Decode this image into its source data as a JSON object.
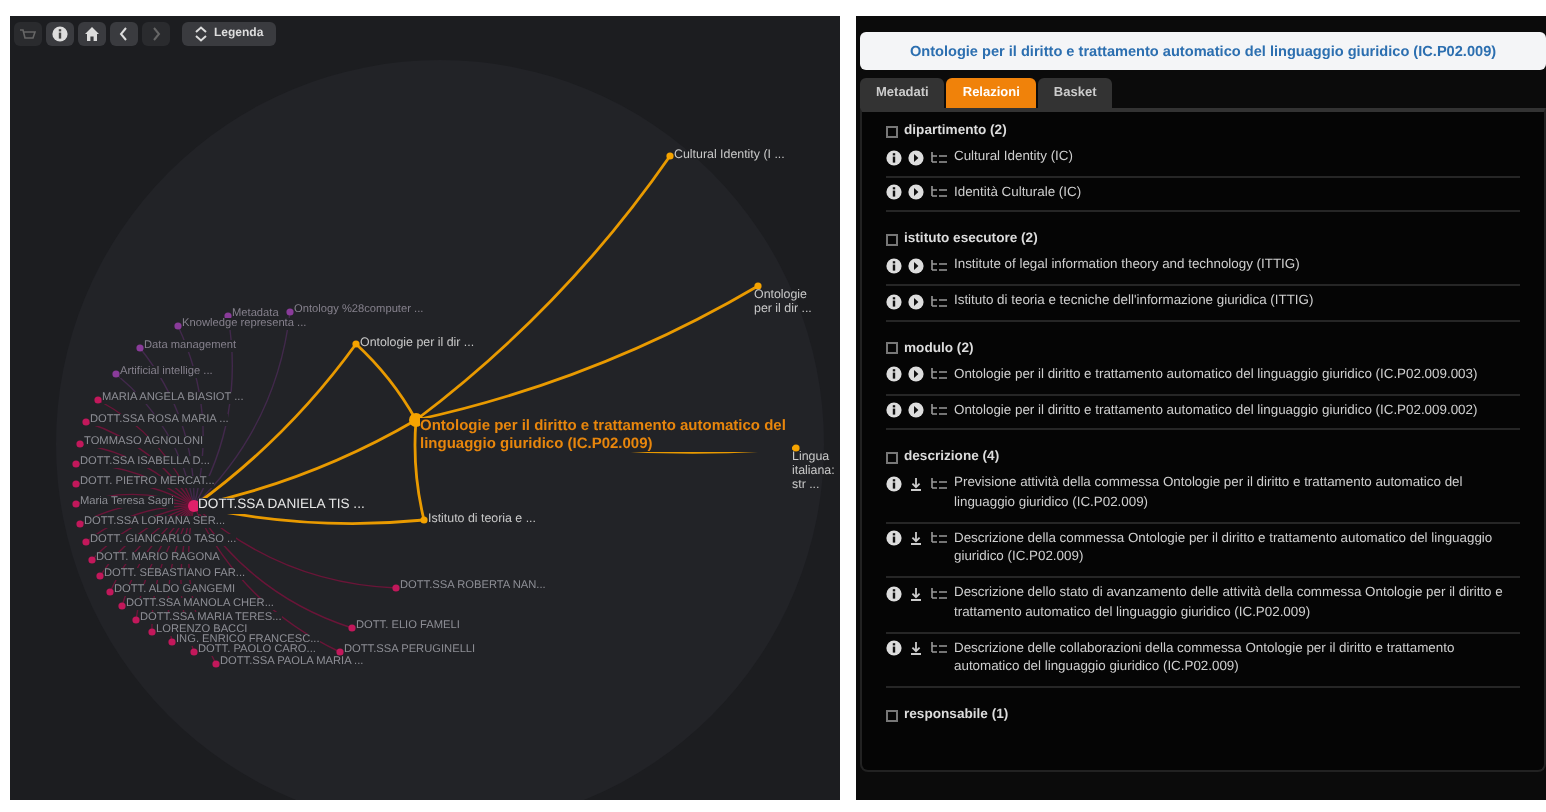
{
  "toolbar": {
    "buttons": [
      {
        "kind": "basket",
        "disabled": true
      },
      {
        "kind": "info",
        "disabled": false
      },
      {
        "kind": "home",
        "disabled": false
      },
      {
        "kind": "back",
        "disabled": false
      },
      {
        "kind": "forward",
        "disabled": true
      }
    ],
    "legend_button": "Legenda"
  },
  "graph": {
    "nodes": [
      {
        "label": "Cultural Identity (I ...",
        "kind": "related"
      },
      {
        "label": "Metadata",
        "kind": "topic"
      },
      {
        "label": "Ontology %28computer ...",
        "kind": "topic"
      },
      {
        "label": "Ontologie per il dir ...",
        "kind": "related"
      },
      {
        "label": "Knowledge representa ...",
        "kind": "topic"
      },
      {
        "label": "Data management",
        "kind": "topic"
      },
      {
        "label": "Ontologie per il dir ...",
        "kind": "related"
      },
      {
        "label": "Artificial intellige ...",
        "kind": "topic"
      },
      {
        "label": "MARIA ANGELA BIASIOT ...",
        "kind": "person"
      },
      {
        "label": "DOTT.SSA ROSA MARIA ...",
        "kind": "person"
      },
      {
        "label": "TOMMASO AGNOLONI",
        "kind": "person"
      },
      {
        "label": "Ontologie per il diritto e trattamento automatico del linguaggio giuridico (IC.P02.009)",
        "kind": "center"
      },
      {
        "label": "DOTT.SSA ISABELLA D...",
        "kind": "person"
      },
      {
        "label": "DOTT. PIETRO MERCAT...",
        "kind": "person"
      },
      {
        "label": "Lingua italiana: str ...",
        "kind": "related"
      },
      {
        "label": "Maria Teresa Sagri",
        "kind": "person"
      },
      {
        "label": "DOTT.SSA DANIELA TIS ...",
        "kind": "focus"
      },
      {
        "label": "DOTT.SSA LORIANA SER...",
        "kind": "person"
      },
      {
        "label": "Istituto di teoria e ...",
        "kind": "related"
      },
      {
        "label": "DOTT. GIANCARLO TASO ...",
        "kind": "person"
      },
      {
        "label": "DOTT. MARIO RAGONA",
        "kind": "person"
      },
      {
        "label": "DOTT. SEBASTIANO FAR...",
        "kind": "person"
      },
      {
        "label": "DOTT. ALDO GANGEMI",
        "kind": "person"
      },
      {
        "label": "DOTT.SSA ROBERTA NAN...",
        "kind": "person"
      },
      {
        "label": "DOTT.SSA MANOLA CHER...",
        "kind": "person"
      },
      {
        "label": "DOTT.SSA MARIA TERES...",
        "kind": "person"
      },
      {
        "label": "LORENZO BACCI",
        "kind": "person"
      },
      {
        "label": "DOTT. ELIO FAMELI",
        "kind": "person"
      },
      {
        "label": "ING. ENRICO FRANCESC...",
        "kind": "person"
      },
      {
        "label": "DOTT. PAOLO CARO...",
        "kind": "person"
      },
      {
        "label": "DOTT.SSA PERUGINELLI",
        "kind": "person"
      },
      {
        "label": "DOTT.SSA PAOLA MARIA ...",
        "kind": "person"
      }
    ]
  },
  "detail": {
    "title": "Ontologie per il diritto e trattamento automatico del linguaggio giuridico (IC.P02.009)",
    "tabs": [
      {
        "label": "Metadati",
        "selected": false
      },
      {
        "label": "Relazioni",
        "selected": true
      },
      {
        "label": "Basket",
        "selected": false
      }
    ],
    "sections": [
      {
        "heading": "dipartimento (2)",
        "items": [
          {
            "kind": "link",
            "text": "Cultural Identity (IC)"
          },
          {
            "kind": "link",
            "text": "Identità Culturale (IC)"
          }
        ]
      },
      {
        "heading": "istituto esecutore (2)",
        "items": [
          {
            "kind": "link",
            "text": "Institute of legal information theory and technology (ITTIG)"
          },
          {
            "kind": "link",
            "text": "Istituto di teoria e tecniche dell'informazione giuridica (ITTIG)"
          }
        ]
      },
      {
        "heading": "modulo (2)",
        "items": [
          {
            "kind": "link",
            "text": "Ontologie per il diritto e trattamento automatico del linguaggio giuridico (IC.P02.009.003)"
          },
          {
            "kind": "link",
            "text": "Ontologie per il diritto e trattamento automatico del linguaggio giuridico (IC.P02.009.002)"
          }
        ]
      },
      {
        "heading": "descrizione (4)",
        "items": [
          {
            "kind": "document",
            "text": "Previsione attività della commessa Ontologie per il diritto e trattamento automatico del linguaggio giuridico (IC.P02.009)"
          },
          {
            "kind": "document",
            "text": "Descrizione della commessa Ontologie per il diritto e trattamento automatico del linguaggio giuridico (IC.P02.009)"
          },
          {
            "kind": "document",
            "text": "Descrizione dello stato di avanzamento delle attività della commessa Ontologie per il diritto e trattamento automatico del linguaggio giuridico (IC.P02.009)"
          },
          {
            "kind": "document",
            "text": "Descrizione delle collaborazioni della commessa Ontologie per il diritto e trattamento automatico del linguaggio giuridico (IC.P02.009)"
          }
        ]
      },
      {
        "heading": "responsabile (1)"
      }
    ]
  }
}
